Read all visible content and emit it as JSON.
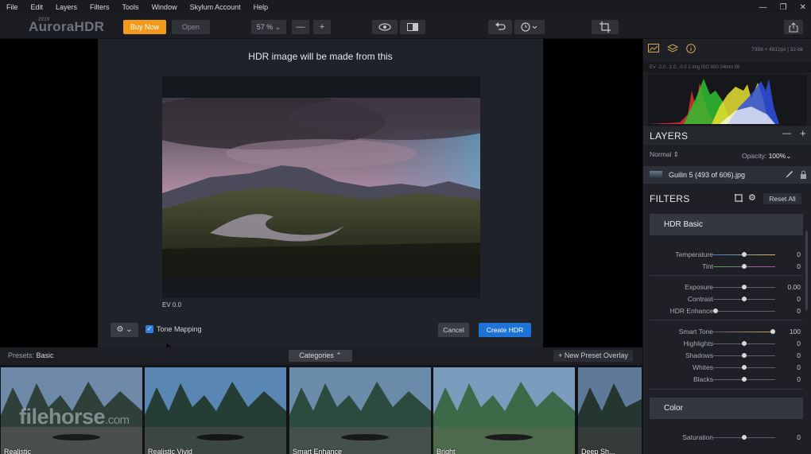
{
  "menubar": {
    "items": [
      "File",
      "Edit",
      "Layers",
      "Filters",
      "Tools",
      "Window",
      "Skylum Account",
      "Help"
    ],
    "window_controls": [
      "—",
      "❐",
      "✕"
    ]
  },
  "toolbar": {
    "logo": "AuroraHDR",
    "logo_small": "2019",
    "buy_label": "Buy Now",
    "open_label": "Open",
    "zoom_label": "57 % ⌄",
    "zoom_out": "—",
    "zoom_in": "+",
    "accent": "#f39a1d"
  },
  "dialog": {
    "title": "HDR image will be made from this",
    "ev_label": "EV 0.0",
    "tone_mapping_label": "Tone Mapping",
    "tone_mapping_checked": true,
    "cancel_label": "Cancel",
    "create_label": "Create HDR",
    "create_color": "#1e73d6"
  },
  "presets": {
    "prefix": "Presets:",
    "name": "Basic",
    "categories_label": "Categories ⌃",
    "new_preset_label": "+ New Preset Overlay",
    "thumbnails": [
      {
        "label": "Realistic"
      },
      {
        "label": "Realistic Vivid"
      },
      {
        "label": "Smart Enhance"
      },
      {
        "label": "Bright"
      },
      {
        "label": "Deep Sh..."
      }
    ]
  },
  "watermark": {
    "main": "filehorse",
    "suffix": ".com"
  },
  "right_panel": {
    "meta": "7359 × 4912px  |  32-bit",
    "hist_info": "EV -2.0...1.0...0.0       2 img   ISO 800   24mm    f/8",
    "layers_title": "LAYERS",
    "layers_minus": "—",
    "layers_plus": "+",
    "blend_mode": "Normal ⇕",
    "opacity_label": "Opacity:",
    "opacity_value": "100%⌄",
    "layer_name": "Guilin 5 (493 of 606).jpg",
    "filters_title": "FILTERS",
    "reset_label": "Reset All",
    "hdr_basic_title": "HDR Basic",
    "color_title": "Color",
    "sliders": [
      {
        "label": "Temperature",
        "value": "0",
        "level": 0.5
      },
      {
        "label": "Tint",
        "value": "0",
        "level": 0.5
      },
      {
        "label": "Exposure",
        "value": "0.00",
        "level": 0.5
      },
      {
        "label": "Contrast",
        "value": "0",
        "level": 0.5
      },
      {
        "label": "HDR Enhance",
        "value": "0",
        "level": 0.0
      },
      {
        "label": "Smart Tone",
        "value": "100",
        "level": 1.0
      },
      {
        "label": "Highlights",
        "value": "0",
        "level": 0.5
      },
      {
        "label": "Shadows",
        "value": "0",
        "level": 0.5
      },
      {
        "label": "Whites",
        "value": "0",
        "level": 0.5
      },
      {
        "label": "Blacks",
        "value": "0",
        "level": 0.5
      },
      {
        "label": "Saturation",
        "value": "0",
        "level": 0.5
      }
    ]
  }
}
